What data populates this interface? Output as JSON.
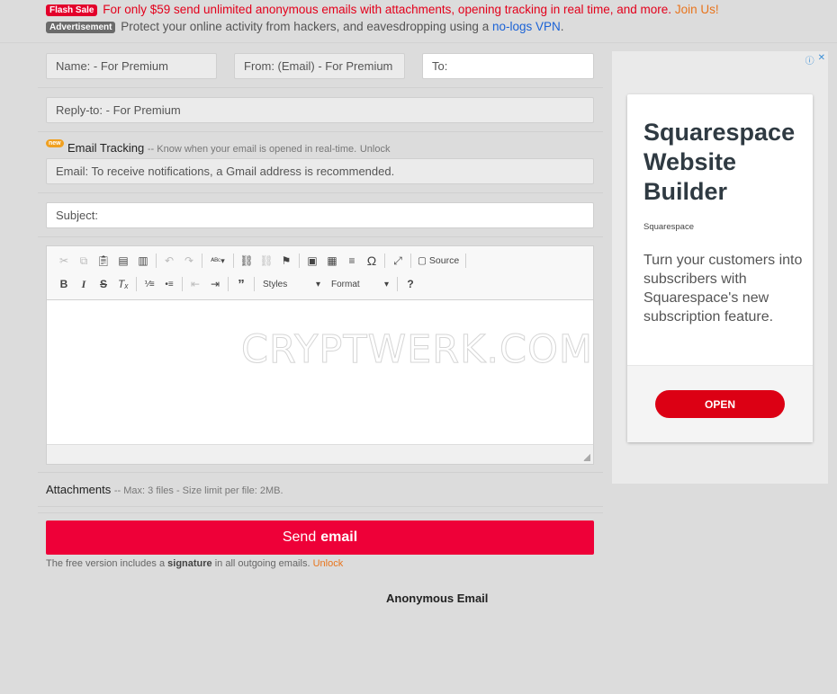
{
  "promo": {
    "flash_badge": "Flash Sale",
    "flash_text": "For only $59 send unlimited anonymous emails with attachments, opening tracking in real time, and more.",
    "flash_link": "Join Us!",
    "ad_badge": "Advertisement",
    "ad_text": "Protect your online activity from hackers, and eavesdropping using a",
    "ad_link": "no-logs VPN",
    "ad_text_end": "."
  },
  "form": {
    "name_placeholder": "Name: - For Premium",
    "from_placeholder": "From: (Email) - For Premium",
    "to_placeholder": "To:",
    "reply_placeholder": "Reply-to: - For Premium",
    "tracking_badge": "new",
    "tracking_label": "Email Tracking",
    "tracking_hint": "-- Know when your email is opened in real-time.",
    "tracking_unlock": "Unlock",
    "tracking_email_placeholder": "Email: To receive notifications, a Gmail address is recommended.",
    "subject_placeholder": "Subject:"
  },
  "editor": {
    "source_label": "Source",
    "styles_label": "Styles",
    "format_label": "Format",
    "watermark": "CRYPTWERK.COM",
    "icons": {
      "cut": "cut-icon",
      "copy": "copy-icon",
      "paste": "paste-icon",
      "paste_text": "paste-text-icon",
      "paste_word": "paste-word-icon",
      "undo": "undo-icon",
      "redo": "redo-icon",
      "spellcheck": "spellcheck-icon",
      "link": "link-icon",
      "unlink": "unlink-icon",
      "anchor": "flag-icon",
      "image": "image-icon",
      "table": "table-icon",
      "hr": "horizontal-rule-icon",
      "special_char": "omega-icon",
      "maximize": "maximize-icon",
      "bold": "bold-icon",
      "italic": "italic-icon",
      "strike": "strikethrough-icon",
      "remove_format": "remove-format-icon",
      "numbered_list": "numbered-list-icon",
      "bulleted_list": "bulleted-list-icon",
      "outdent": "outdent-icon",
      "indent": "indent-icon",
      "blockquote": "blockquote-icon",
      "help": "help-icon"
    }
  },
  "attachments": {
    "label": "Attachments",
    "hint": "-- Max: 3 files - Size limit per file: 2MB."
  },
  "send": {
    "label_normal": "Send",
    "label_bold": "email"
  },
  "free_note": {
    "text_before": "The free version includes a",
    "bold": "signature",
    "text_after": "in all outgoing emails.",
    "unlock": "Unlock"
  },
  "footer": {
    "title": "Anonymous Email"
  },
  "ad": {
    "title": "Squarespace Website Builder",
    "brand": "Squarespace",
    "body": "Turn your customers into subscribers with Squarespace's new subscription feature.",
    "cta": "OPEN",
    "accent_color": "#dc0014"
  },
  "colors": {
    "send_button": "#ee0038",
    "flash_red": "#e3001b",
    "link_orange": "#e8741c",
    "link_blue": "#1a62d6"
  }
}
